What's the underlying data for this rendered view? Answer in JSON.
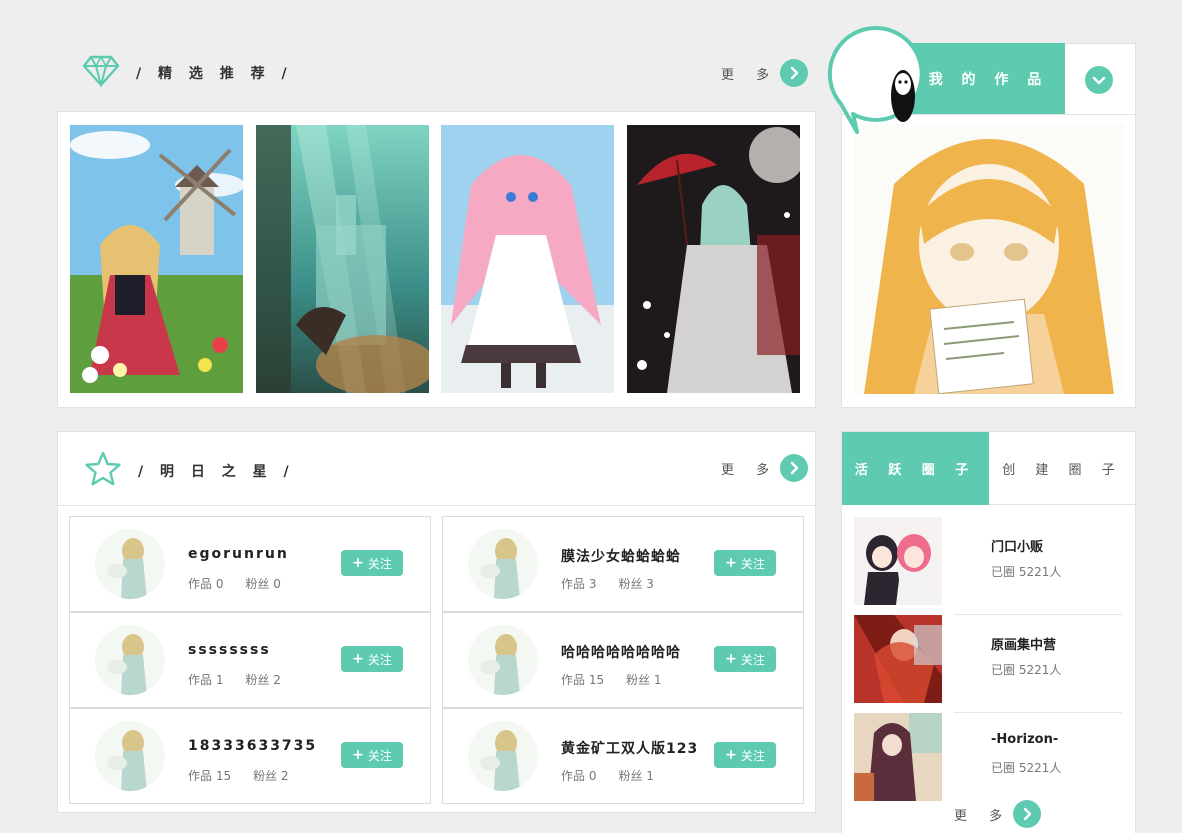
{
  "featured": {
    "title": "/ 精 选 推 荐 /",
    "more_label": "更 多",
    "icon": "diamond-icon",
    "artworks": [
      {
        "name": "artwork-windmill-girl"
      },
      {
        "name": "artwork-underwater-city"
      },
      {
        "name": "artwork-pink-hair-girl"
      },
      {
        "name": "artwork-umbrella-girl"
      }
    ]
  },
  "my_works": {
    "tab_label": "我 的 作 品",
    "toggle_icon": "chevron-down-icon",
    "avatar_icon": "no-face-avatar"
  },
  "stars": {
    "title": "/ 明 日 之 星 /",
    "more_label": "更 多",
    "icon": "star-outline-icon",
    "users": [
      {
        "name": "egorunrun",
        "works": "作品 0",
        "fans": "粉丝 0",
        "follow": "关注"
      },
      {
        "name": "膜法少女蛤蛤蛤蛤",
        "works": "作品 3",
        "fans": "粉丝 3",
        "follow": "关注"
      },
      {
        "name": "ssssssss",
        "works": "作品 1",
        "fans": "粉丝 2",
        "follow": "关注"
      },
      {
        "name": "哈哈哈哈哈哈哈哈",
        "works": "作品 15",
        "fans": "粉丝 1",
        "follow": "关注"
      },
      {
        "name": "18333633735",
        "works": "作品 15",
        "fans": "粉丝 2",
        "follow": "关注"
      },
      {
        "name": "黄金矿工双人版123",
        "works": "作品 0",
        "fans": "粉丝 1",
        "follow": "关注"
      }
    ]
  },
  "circles": {
    "tab_active": "活 跃 圈 子",
    "tab_inactive": "创 建 圈 子",
    "more_label": "更 多",
    "items": [
      {
        "name": "门口小贩",
        "members": "已圈 5221人"
      },
      {
        "name": "原画集中营",
        "members": "已圈 5221人"
      },
      {
        "name": "-Horizon-",
        "members": "已圈 5221人"
      }
    ]
  },
  "colors": {
    "accent": "#5ecbb0",
    "background": "#eeeeee"
  }
}
